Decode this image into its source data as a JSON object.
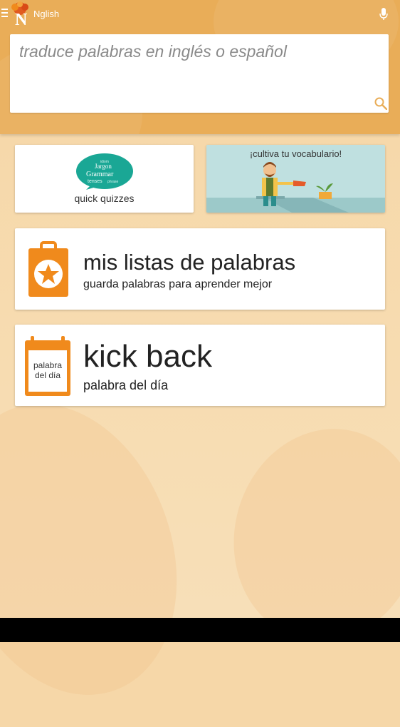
{
  "app": {
    "title": "Nglish"
  },
  "search": {
    "placeholder": "traduce palabras en inglés o español"
  },
  "tiles": {
    "quiz": {
      "label": "quick quizzes"
    },
    "vocab": {
      "label": "¡cultiva tu vocabulario!"
    }
  },
  "lists": {
    "title": "mis listas de palabras",
    "subtitle": "guarda palabras para aprender mejor"
  },
  "word_of_day": {
    "icon_text": [
      "palabra",
      "del día"
    ],
    "word": "kick back",
    "subtitle": "palabra del día"
  },
  "colors": {
    "accent": "#e9ad58",
    "icon_orange": "#f08a1c",
    "background": "#f6d7a8"
  },
  "icons": [
    "menu-icon",
    "app-logo",
    "microphone-icon",
    "search-icon",
    "clipboard-star-icon",
    "calendar-icon"
  ]
}
